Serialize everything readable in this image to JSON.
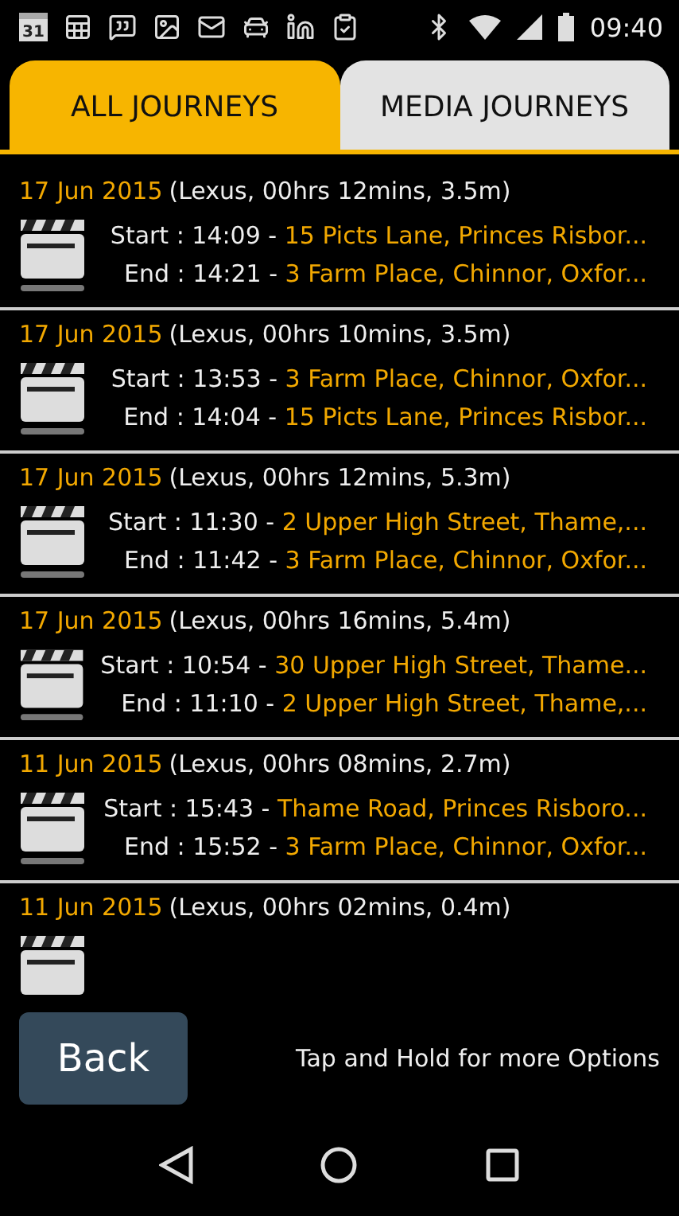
{
  "status_bar": {
    "time": "09:40",
    "calendar_day": "31"
  },
  "tabs": [
    {
      "label": "ALL JOURNEYS",
      "selected": true
    },
    {
      "label": "MEDIA JOURNEYS",
      "selected": false
    }
  ],
  "journeys": [
    {
      "date": "17 Jun 2015",
      "summary": "(Lexus, 00hrs 12mins, 3.5m)",
      "start_label": "Start : 14:09 - ",
      "start_place": "15 Picts Lane, Princes Risbor...",
      "end_label": "End : 14:21 - ",
      "end_place": "3 Farm Place, Chinnor, Oxfor..."
    },
    {
      "date": "17 Jun 2015",
      "summary": "(Lexus, 00hrs 10mins, 3.5m)",
      "start_label": "Start : 13:53 - ",
      "start_place": "3 Farm Place, Chinnor, Oxfor...",
      "end_label": "End : 14:04 - ",
      "end_place": "15 Picts Lane, Princes Risbor..."
    },
    {
      "date": "17 Jun 2015",
      "summary": "(Lexus, 00hrs 12mins, 5.3m)",
      "start_label": "Start : 11:30 - ",
      "start_place": "2 Upper High Street, Thame,...",
      "end_label": "End : 11:42 - ",
      "end_place": "3 Farm Place, Chinnor, Oxfor..."
    },
    {
      "date": "17 Jun 2015",
      "summary": "(Lexus, 00hrs 16mins, 5.4m)",
      "start_label": "Start : 10:54 - ",
      "start_place": "30 Upper High Street, Thame...",
      "end_label": "End : 11:10 - ",
      "end_place": "2 Upper High Street, Thame,..."
    },
    {
      "date": "11 Jun 2015",
      "summary": "(Lexus, 00hrs 08mins, 2.7m)",
      "start_label": "Start : 15:43 - ",
      "start_place": "Thame Road, Princes Risboro...",
      "end_label": "End : 15:52 - ",
      "end_place": "3 Farm Place, Chinnor, Oxfor..."
    },
    {
      "date": "11 Jun 2015",
      "summary": "(Lexus, 00hrs 02mins, 0.4m)"
    }
  ],
  "back_button": "Back",
  "hint": "Tap and Hold for more Options"
}
